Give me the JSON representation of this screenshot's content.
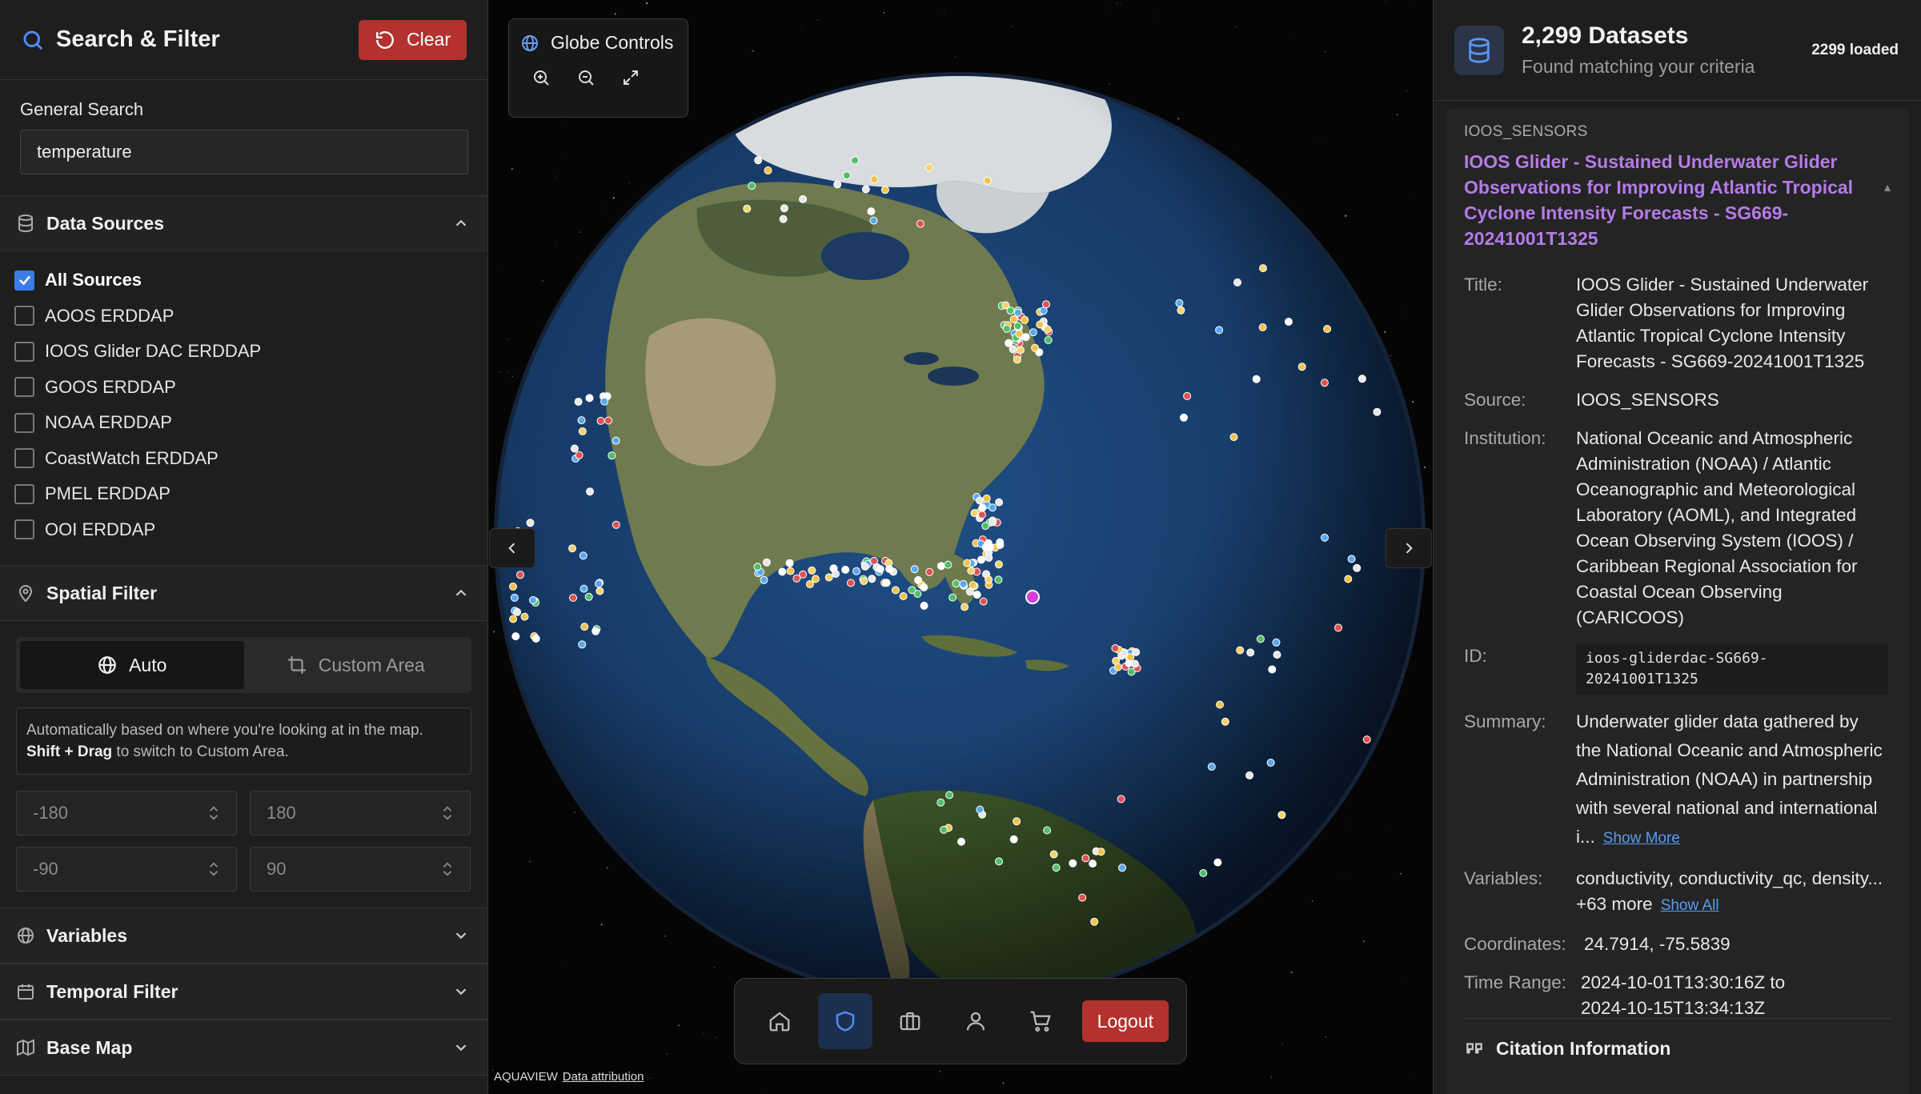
{
  "left_panel": {
    "title": "Search & Filter",
    "clear_label": "Clear",
    "general_search": {
      "label": "General Search",
      "value": "temperature"
    },
    "data_sources": {
      "title": "Data Sources",
      "items": [
        {
          "label": "All Sources",
          "checked": true
        },
        {
          "label": "AOOS ERDDAP",
          "checked": false
        },
        {
          "label": "IOOS Glider DAC ERDDAP",
          "checked": false
        },
        {
          "label": "GOOS ERDDAP",
          "checked": false
        },
        {
          "label": "NOAA ERDDAP",
          "checked": false
        },
        {
          "label": "CoastWatch ERDDAP",
          "checked": false
        },
        {
          "label": "PMEL ERDDAP",
          "checked": false
        },
        {
          "label": "OOI ERDDAP",
          "checked": false
        }
      ]
    },
    "spatial_filter": {
      "title": "Spatial Filter",
      "mode_auto": "Auto",
      "mode_custom": "Custom Area",
      "hint_line1": "Automatically based on where you're looking at in the map.",
      "hint_bold": "Shift + Drag",
      "hint_line2": " to switch to Custom Area.",
      "min_lon": "-180",
      "max_lon": "180",
      "min_lat": "-90",
      "max_lat": "90"
    },
    "variables_title": "Variables",
    "temporal_title": "Temporal Filter",
    "basemap_title": "Base Map"
  },
  "globe": {
    "controls_title": "Globe Controls",
    "logout_label": "Logout",
    "attribution_brand": "AQUAVIEW",
    "attribution_link": "Data attribution"
  },
  "right_panel": {
    "count": "2,299 Datasets",
    "subtitle": "Found matching your criteria",
    "loaded": "2299 loaded",
    "card": {
      "source_tag": "IOOS_SENSORS",
      "heading": "IOOS Glider - Sustained Underwater Glider Observations for Improving Atlantic Tropical Cyclone Intensity Forecasts - SG669-20241001T1325",
      "title_label": "Title:",
      "title_value": "IOOS Glider - Sustained Underwater Glider Observations for Improving Atlantic Tropical Cyclone Intensity Forecasts - SG669-20241001T1325",
      "source_label": "Source:",
      "source_value": "IOOS_SENSORS",
      "institution_label": "Institution:",
      "institution_value": "National Oceanic and Atmospheric Administration (NOAA) / Atlantic Oceanographic and Meteorological Laboratory (AOML), and Integrated Ocean Observing System (IOOS) / Caribbean Regional Association for Coastal Ocean Observing (CARICOOS)",
      "id_label": "ID:",
      "id_value": "ioos-gliderdac-SG669-20241001T1325",
      "summary_label": "Summary:",
      "summary_value": "Underwater glider data gathered by the National Oceanic and Atmospheric Administration (NOAA) in partnership with several national and international i...",
      "show_more": "Show More",
      "variables_label": "Variables:",
      "variables_value": "conductivity, conductivity_qc, density... +63 more",
      "show_all": "Show All",
      "coordinates_label": "Coordinates:",
      "coordinates_value": "24.7914, -75.5839",
      "time_label": "Time Range:",
      "time_value_1": "2024-10-01T13:30:16Z to",
      "time_value_2": "2024-10-15T13:34:13Z",
      "citation_label": "Citation Information"
    }
  },
  "colors": {
    "accent_red": "#b3322e",
    "accent_blue": "#3b7de8",
    "title_purple": "#b57be8"
  }
}
